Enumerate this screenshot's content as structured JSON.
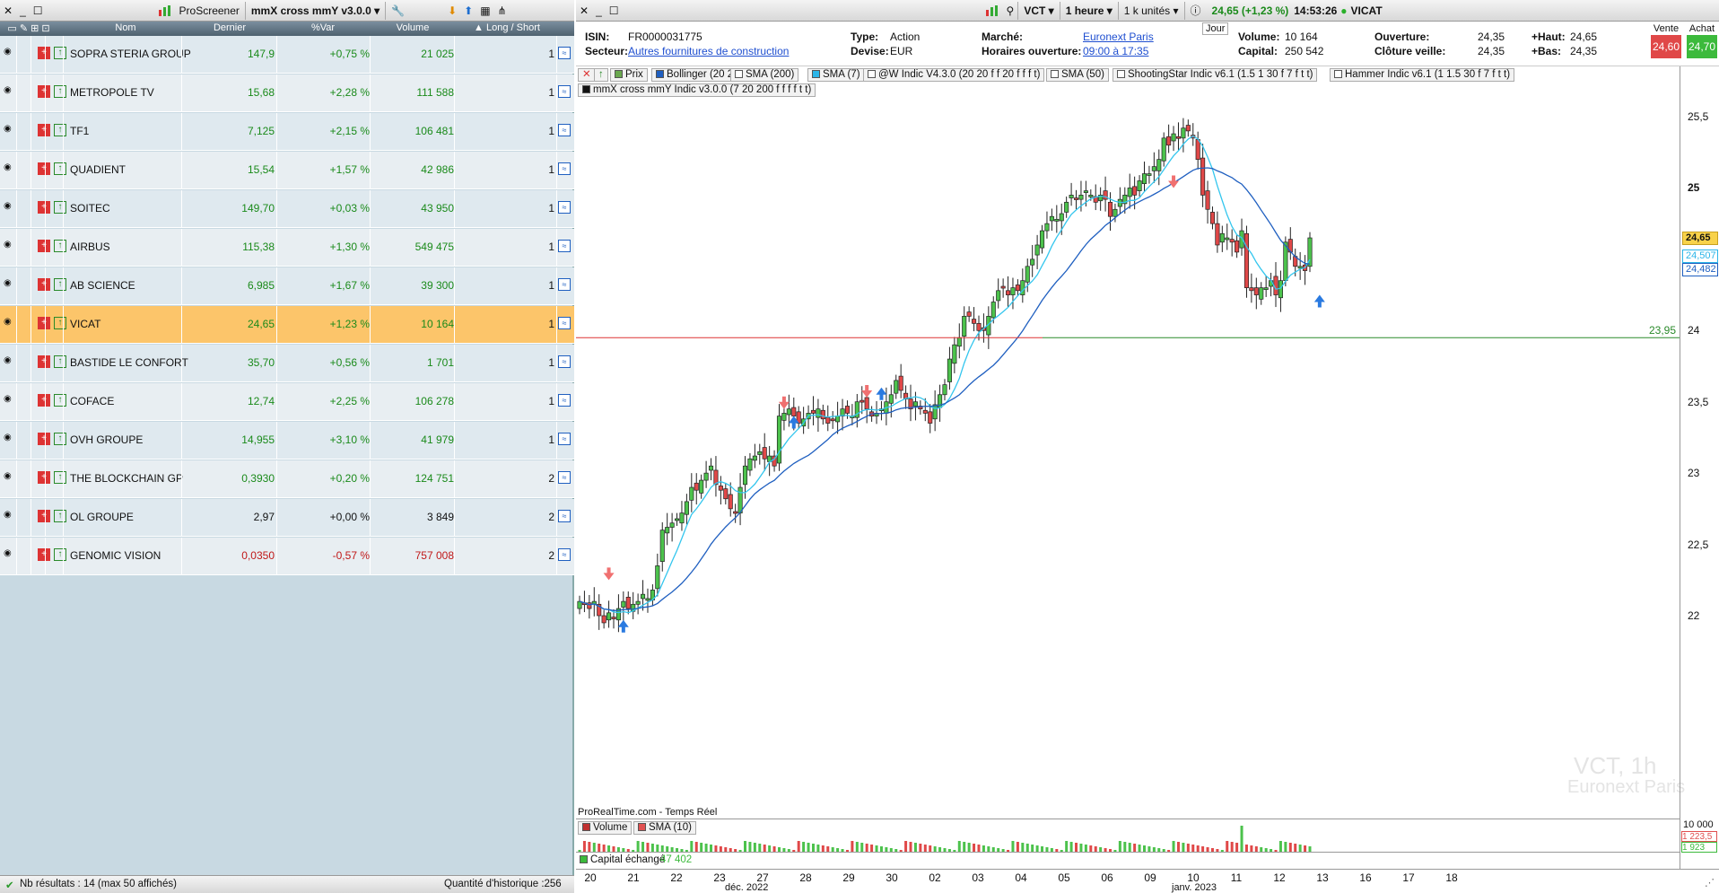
{
  "screener": {
    "app_name": "ProScreener",
    "screener_name": "mmX cross mmY v3.0.0",
    "columns": [
      "Nom",
      "Dernier",
      "%Var",
      "Volume",
      "Long / Short"
    ],
    "rows": [
      {
        "name": "SOPRA STERIA GROUP",
        "last": "147,9",
        "var": "+0,75 %",
        "volume": "21 025",
        "ls": "1",
        "dir": "up"
      },
      {
        "name": "METROPOLE TV",
        "last": "15,68",
        "var": "+2,28 %",
        "volume": "111 588",
        "ls": "1",
        "dir": "up"
      },
      {
        "name": "TF1",
        "last": "7,125",
        "var": "+2,15 %",
        "volume": "106 481",
        "ls": "1",
        "dir": "up"
      },
      {
        "name": "QUADIENT",
        "last": "15,54",
        "var": "+1,57 %",
        "volume": "42 986",
        "ls": "1",
        "dir": "up"
      },
      {
        "name": "SOITEC",
        "last": "149,70",
        "var": "+0,03 %",
        "volume": "43 950",
        "ls": "1",
        "dir": "up"
      },
      {
        "name": "AIRBUS",
        "last": "115,38",
        "var": "+1,30 %",
        "volume": "549 475",
        "ls": "1",
        "dir": "up"
      },
      {
        "name": "AB SCIENCE",
        "last": "6,985",
        "var": "+1,67 %",
        "volume": "39 300",
        "ls": "1",
        "dir": "up"
      },
      {
        "name": "VICAT",
        "last": "24,65",
        "var": "+1,23 %",
        "volume": "10 164",
        "ls": "1",
        "dir": "up",
        "selected": true
      },
      {
        "name": "BASTIDE LE CONFORT",
        "last": "35,70",
        "var": "+0,56 %",
        "volume": "1 701",
        "ls": "1",
        "dir": "up"
      },
      {
        "name": "COFACE",
        "last": "12,74",
        "var": "+2,25 %",
        "volume": "106 278",
        "ls": "1",
        "dir": "up"
      },
      {
        "name": "OVH GROUPE",
        "last": "14,955",
        "var": "+3,10 %",
        "volume": "41 979",
        "ls": "1",
        "dir": "up"
      },
      {
        "name": "THE BLOCKCHAIN GP",
        "last": "0,3930",
        "var": "+0,20 %",
        "volume": "124 751",
        "ls": "2",
        "dir": "up"
      },
      {
        "name": "OL GROUPE",
        "last": "2,97",
        "var": "+0,00 %",
        "volume": "3 849",
        "ls": "2",
        "dir": "flat"
      },
      {
        "name": "GENOMIC VISION",
        "last": "0,0350",
        "var": "-0,57 %",
        "volume": "757 008",
        "ls": "2",
        "dir": "down"
      }
    ],
    "footer_results": "Nb résultats : 14 (max 50 affichés)",
    "footer_history": "Quantité d'historique :256"
  },
  "chart_window": {
    "ticker": "VCT",
    "timeframe": "1 heure",
    "units": "1 k unités",
    "quote": "24,65 (+1,23 %)",
    "time": "14:53:26",
    "name": "VICAT",
    "isin_label": "ISIN:",
    "isin": "FR0000031775",
    "secteur_label": "Secteur:",
    "secteur": "Autres fournitures de construction",
    "type_label": "Type:",
    "type": "Action",
    "devise_label": "Devise:",
    "devise": "EUR",
    "marche_label": "Marché:",
    "marche": "Euronext Paris",
    "horaires_label": "Horaires ouverture:",
    "horaires": "09:00 à 17:35",
    "jour": "Jour",
    "volume_label": "Volume:",
    "volume": "10 164",
    "capital_label": "Capital:",
    "capital": "250 542",
    "ouverture_label": "Ouverture:",
    "ouverture": "24,35",
    "cloture_label": "Clôture veille:",
    "cloture": "24,35",
    "haut_label": "+Haut:",
    "haut": "24,65",
    "bas_label": "+Bas:",
    "bas": "24,35",
    "vente_label": "Vente",
    "vente": "24,60",
    "achat_label": "Achat",
    "achat": "24,70",
    "indicators_row1": [
      "Prix",
      "Bollinger (20 2)",
      "SMA (200)",
      "SMA (7)",
      "@W Indic V4.3.0 (20 20 f f 20 f f f t)",
      "SMA (50)",
      "ShootingStar Indic v6.1 (1.5 1 30 f 7 f t t)",
      "Hammer Indic v6.1 (1 1.5 30 f 7 f t t)"
    ],
    "indicators_row2": "mmX cross mmY Indic v3.0.0 (7 20 200 f f f f t t)",
    "hline_label": "23,95",
    "price_tag_last": "24,65",
    "price_tag_sma7": "24,507",
    "price_tag_sma20": "24,482",
    "watermark_1": "VCT, 1h",
    "watermark_2": "Euronext Paris",
    "source": "ProRealTime.com - Temps Réel",
    "volume_panel_label": "Volume",
    "volume_sma_label": "SMA (10)",
    "vol_axis_top": "10 000",
    "vol_tag_1": "1 223,5",
    "vol_tag_2": "1 923",
    "capital_panel": "Capital échangé",
    "capital_value": "47 402",
    "x_labels": [
      "20",
      "21",
      "22",
      "23",
      "27",
      "28",
      "29",
      "30",
      "02",
      "03",
      "04",
      "05",
      "06",
      "09",
      "10",
      "11",
      "12",
      "13",
      "16",
      "17",
      "18"
    ],
    "x_month_1": "déc. 2022",
    "x_month_2": "janv. 2023",
    "y_ticks": [
      "25,5",
      "25",
      "24,5",
      "24",
      "23,5",
      "23",
      "22,5",
      "22"
    ]
  },
  "chart_data": {
    "type": "candlestick",
    "title": "VCT, 1h",
    "ylim": [
      21.9,
      25.85
    ],
    "y_ticks": [
      22,
      22.5,
      23,
      23.5,
      24,
      24.5,
      25,
      25.5
    ],
    "horizontal_line": 23.95,
    "closes": [
      22.1,
      22.08,
      22.05,
      22.1,
      22.0,
      21.95,
      22.02,
      21.98,
      22.05,
      22.1,
      22.05,
      22.08,
      22.1,
      22.15,
      22.12,
      22.18,
      22.35,
      22.6,
      22.62,
      22.65,
      22.68,
      22.72,
      22.8,
      22.9,
      22.88,
      22.95,
      23.0,
      23.05,
      22.92,
      22.88,
      22.82,
      22.75,
      22.72,
      22.9,
      23.05,
      23.1,
      23.12,
      23.15,
      23.1,
      23.12,
      23.05,
      23.4,
      23.42,
      23.45,
      23.4,
      23.35,
      23.38,
      23.42,
      23.42,
      23.45,
      23.38,
      23.35,
      23.38,
      23.4,
      23.45,
      23.42,
      23.4,
      23.5,
      23.5,
      23.45,
      23.4,
      23.42,
      23.45,
      23.5,
      23.55,
      23.65,
      23.58,
      23.52,
      23.45,
      23.5,
      23.45,
      23.42,
      23.35,
      23.48,
      23.55,
      23.62,
      23.8,
      23.9,
      23.95,
      24.1,
      24.1,
      24.05,
      24.0,
      24.0,
      24.1,
      24.2,
      24.28,
      24.3,
      24.25,
      24.3,
      24.28,
      24.35,
      24.45,
      24.5,
      24.6,
      24.7,
      24.75,
      24.8,
      24.78,
      24.82,
      24.9,
      24.95,
      24.92,
      24.95,
      24.98,
      24.95,
      24.9,
      24.95,
      24.92,
      24.8,
      24.85,
      24.92,
      24.95,
      25.0,
      24.95,
      25.05,
      25.1,
      25.1,
      25.15,
      25.2,
      25.35,
      25.3,
      25.38,
      25.35,
      25.42,
      25.4,
      25.35,
      25.2,
      24.95,
      24.85,
      24.75,
      24.6,
      24.68,
      24.65,
      24.62,
      24.55,
      24.7,
      24.3,
      24.28,
      24.25,
      24.3,
      24.3,
      24.35,
      24.25,
      24.35,
      24.62,
      24.55,
      24.45,
      24.45,
      24.42,
      24.65
    ]
  }
}
